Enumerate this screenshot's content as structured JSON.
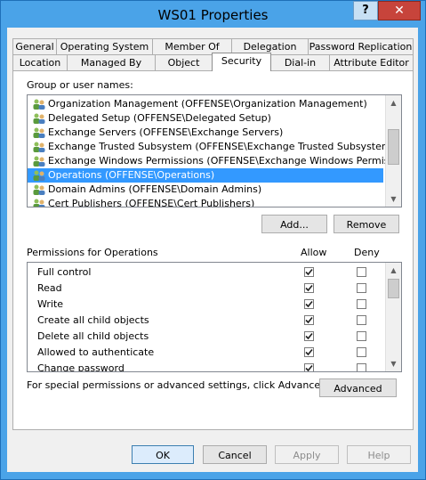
{
  "window": {
    "title": "WS01 Properties",
    "help": "?",
    "close": "✕"
  },
  "tabs_row1": [
    "General",
    "Operating System",
    "Member Of",
    "Delegation",
    "Password Replication"
  ],
  "tabs_row2": [
    "Location",
    "Managed By",
    "Object",
    "Security",
    "Dial-in",
    "Attribute Editor"
  ],
  "active_tab": "Security",
  "group_label": "Group or user names:",
  "users": [
    "Organization Management (OFFENSE\\Organization Management)",
    "Delegated Setup (OFFENSE\\Delegated Setup)",
    "Exchange Servers (OFFENSE\\Exchange Servers)",
    "Exchange Trusted Subsystem (OFFENSE\\Exchange Trusted Subsystem)",
    "Exchange Windows Permissions (OFFENSE\\Exchange Windows Permissions)",
    "Operations (OFFENSE\\Operations)",
    "Domain Admins (OFFENSE\\Domain Admins)",
    "Cert Publishers (OFFENSE\\Cert Publishers)"
  ],
  "selected_user_index": 5,
  "buttons": {
    "add": "Add...",
    "remove": "Remove",
    "advanced": "Advanced",
    "ok": "OK",
    "cancel": "Cancel",
    "apply": "Apply",
    "help": "Help"
  },
  "permissions_label": "Permissions for Operations",
  "allow_label": "Allow",
  "deny_label": "Deny",
  "permissions": [
    {
      "name": "Full control",
      "allow": true,
      "deny": false
    },
    {
      "name": "Read",
      "allow": true,
      "deny": false
    },
    {
      "name": "Write",
      "allow": true,
      "deny": false
    },
    {
      "name": "Create all child objects",
      "allow": true,
      "deny": false
    },
    {
      "name": "Delete all child objects",
      "allow": true,
      "deny": false
    },
    {
      "name": "Allowed to authenticate",
      "allow": true,
      "deny": false
    },
    {
      "name": "Change password",
      "allow": true,
      "deny": false
    }
  ],
  "advanced_note": "For special permissions or advanced settings, click Advanced.",
  "colors": {
    "titlebar": "#4aa3e8",
    "selection": "#3399ff",
    "close": "#c7443b"
  }
}
